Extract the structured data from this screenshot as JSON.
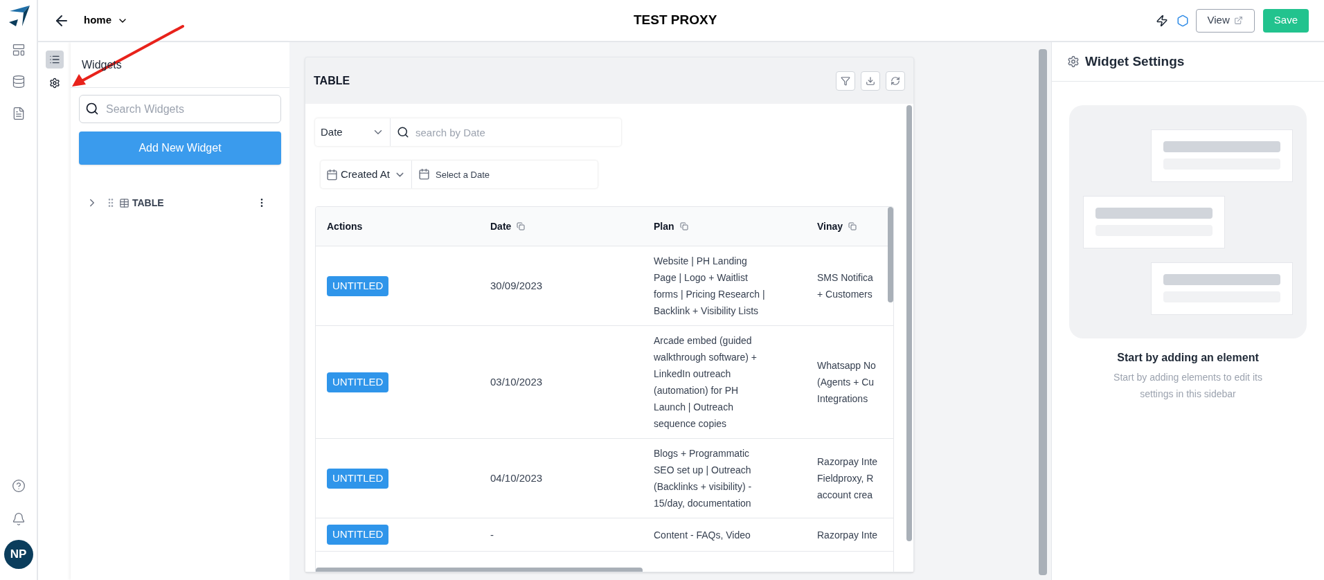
{
  "app_rail": {
    "avatar": "NP"
  },
  "top_bar": {
    "page_selector": "home",
    "title": "TEST PROXY",
    "view_button": "View",
    "save_button": "Save"
  },
  "panel_tabs": [
    {
      "kind": "list",
      "selected": true
    },
    {
      "kind": "settings",
      "selected": false
    }
  ],
  "widgets_panel": {
    "title": "Widgets",
    "search": {
      "placeholder": "Search Widgets"
    },
    "add_button": "Add New Widget",
    "tree": [
      {
        "label": "TABLE",
        "expanded": false
      }
    ]
  },
  "table_widget": {
    "title": "TABLE",
    "search_filter": {
      "column": "Date",
      "placeholder": "search by Date"
    },
    "date_filter": {
      "column": "Created At",
      "placeholder": "Select a Date"
    },
    "columns": [
      "Actions",
      "Date",
      "Plan",
      "Vinay"
    ],
    "rows": [
      {
        "action": "UNTITLED",
        "date": "30/09/2023",
        "plan": [
          "Website | PH Landing",
          "Page | Logo + Waitlist",
          "forms | Pricing Research |",
          "Backlink + Visibility Lists"
        ],
        "vinay": [
          "SMS Notifica",
          "+ Customers"
        ]
      },
      {
        "action": "UNTITLED",
        "date": "03/10/2023",
        "plan": [
          "Arcade embed (guided",
          "walkthrough software) +",
          "LinkedIn outreach",
          "(automation) for PH",
          "Launch | Outreach",
          "sequence copies"
        ],
        "vinay": [
          "Whatsapp No",
          "(Agents + Cu",
          "Integrations"
        ]
      },
      {
        "action": "UNTITLED",
        "date": "04/10/2023",
        "plan": [
          "Blogs + Programmatic",
          "SEO set up | Outreach",
          "(Backlinks + visibility) -",
          "15/day, documentation"
        ],
        "vinay": [
          "Razorpay Inte",
          "Fieldproxy, R",
          "account crea"
        ]
      },
      {
        "action": "UNTITLED",
        "date": "-",
        "plan": [
          "Content - FAQs, Video"
        ],
        "vinay": [
          "Razorpay Inte"
        ]
      }
    ]
  },
  "settings_panel": {
    "title": "Widget Settings",
    "empty_title": "Start by adding an element",
    "empty_text": "Start by adding elements to edit its settings in this sidebar"
  }
}
